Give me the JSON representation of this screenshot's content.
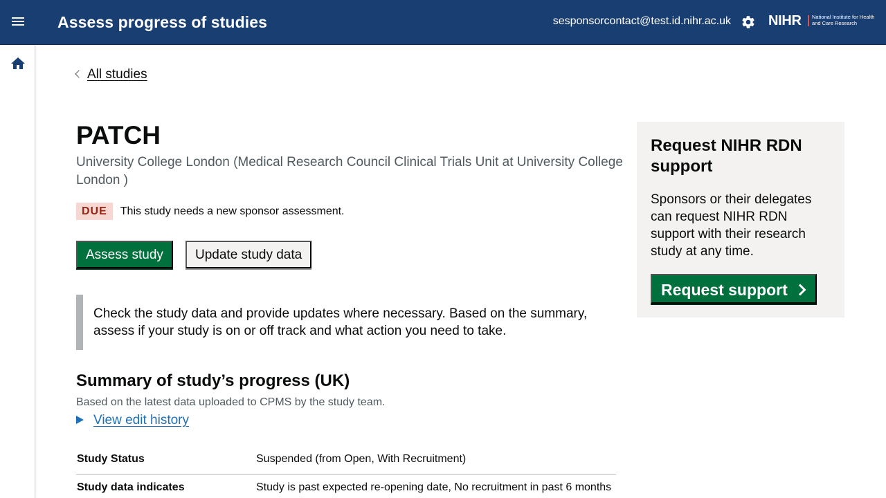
{
  "header": {
    "title": "Assess progress of studies",
    "user_email": "sesponsorcontact@test.id.nihr.ac.uk",
    "logo_text": "NIHR",
    "logo_subtext": "National Institute for Health and Care Research",
    "background_color": "#193e72"
  },
  "icons": {
    "menu": "hamburger-menu-icon",
    "settings": "gear-icon",
    "home": "home-icon"
  },
  "breadcrumb": {
    "back_label": "All studies"
  },
  "study": {
    "title": "PATCH",
    "organisation": "University College London (Medical Research Council Clinical Trials Unit at University College London )",
    "status_tag": "DUE",
    "status_message": "This study needs a new sponsor assessment.",
    "tag_color": "#f6d7d2"
  },
  "actions": {
    "assess_label": "Assess study",
    "update_label": "Update study data",
    "primary_color": "#00703c"
  },
  "inset_text": "Check the study data and provide updates where necessary. Based on the summary, assess if your study is on or off track and what action you need to take.",
  "summary": {
    "heading": "Summary of study’s progress (UK)",
    "subtext": "Based on the latest data uploaded to CPMS by the study team.",
    "details_label": "View edit history",
    "rows": [
      {
        "key": "Study Status",
        "value": "Suspended (from Open, With Recruitment)"
      },
      {
        "key": "Study data indicates",
        "value": "Study is past expected re-opening date, No recruitment in past 6 months"
      }
    ]
  },
  "support_panel": {
    "heading": "Request NIHR RDN support",
    "body": "Sponsors or their delegates can request NIHR RDN support with their research study at any time.",
    "button_label": "Request support"
  }
}
